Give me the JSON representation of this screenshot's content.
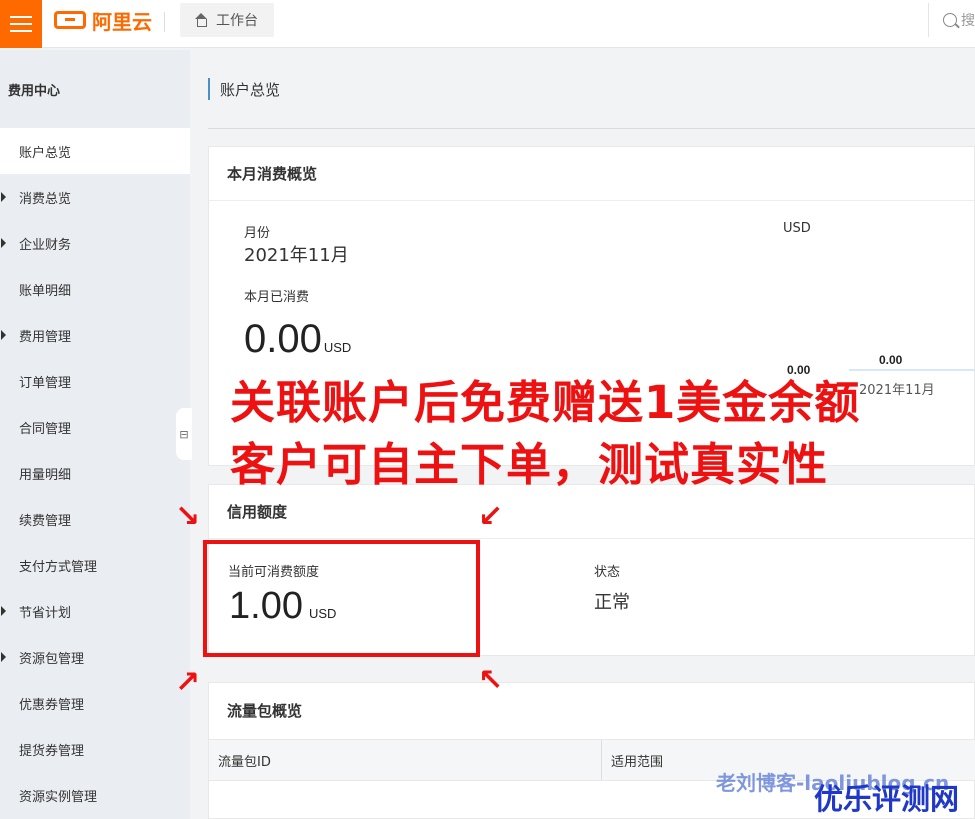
{
  "header": {
    "brand": "阿里云",
    "workbench_label": "工作台",
    "search_placeholder": "搜"
  },
  "sidebar": {
    "title": "费用中心",
    "items": [
      {
        "label": "账户总览",
        "expandable": false,
        "active": true
      },
      {
        "label": "消费总览",
        "expandable": true,
        "active": false
      },
      {
        "label": "企业财务",
        "expandable": true,
        "active": false
      },
      {
        "label": "账单明细",
        "expandable": false,
        "active": false
      },
      {
        "label": "费用管理",
        "expandable": true,
        "active": false
      },
      {
        "label": "订单管理",
        "expandable": false,
        "active": false
      },
      {
        "label": "合同管理",
        "expandable": false,
        "active": false
      },
      {
        "label": "用量明细",
        "expandable": false,
        "active": false
      },
      {
        "label": "续费管理",
        "expandable": false,
        "active": false
      },
      {
        "label": "支付方式管理",
        "expandable": false,
        "active": false
      },
      {
        "label": "节省计划",
        "expandable": true,
        "active": false
      },
      {
        "label": "资源包管理",
        "expandable": true,
        "active": false
      },
      {
        "label": "优惠券管理",
        "expandable": false,
        "active": false
      },
      {
        "label": "提货券管理",
        "expandable": false,
        "active": false
      },
      {
        "label": "资源实例管理",
        "expandable": false,
        "active": false
      }
    ],
    "collapse_handle": "⊟"
  },
  "main": {
    "breadcrumb": "账户总览",
    "monthly": {
      "title": "本月消费概览",
      "month_label": "月份",
      "month_value": "2021年11月",
      "currency_label": "USD",
      "spent_label": "本月已消费",
      "spent_value": "0.00",
      "spent_unit": "USD",
      "chart_values": [
        "0.00",
        "0.00"
      ],
      "chart_axis_label": "2021年11月"
    },
    "credit": {
      "title": "信用额度",
      "available_label": "当前可消费额度",
      "available_value": "1.00",
      "available_unit": "USD",
      "status_label": "状态",
      "status_value": "正常"
    },
    "traffic": {
      "title": "流量包概览",
      "columns": [
        "流量包ID",
        "适用范围"
      ]
    }
  },
  "annotation": {
    "line1": "关联账户后免费赠送1美金余额",
    "line2": "客户可自主下单，测试真实性",
    "arrows": [
      "↘",
      "↙",
      "↗",
      "↖"
    ],
    "color": "#ee1111"
  },
  "watermark": {
    "text1": "老刘博客-laoliublog.cn",
    "text2": "优乐评测网"
  }
}
